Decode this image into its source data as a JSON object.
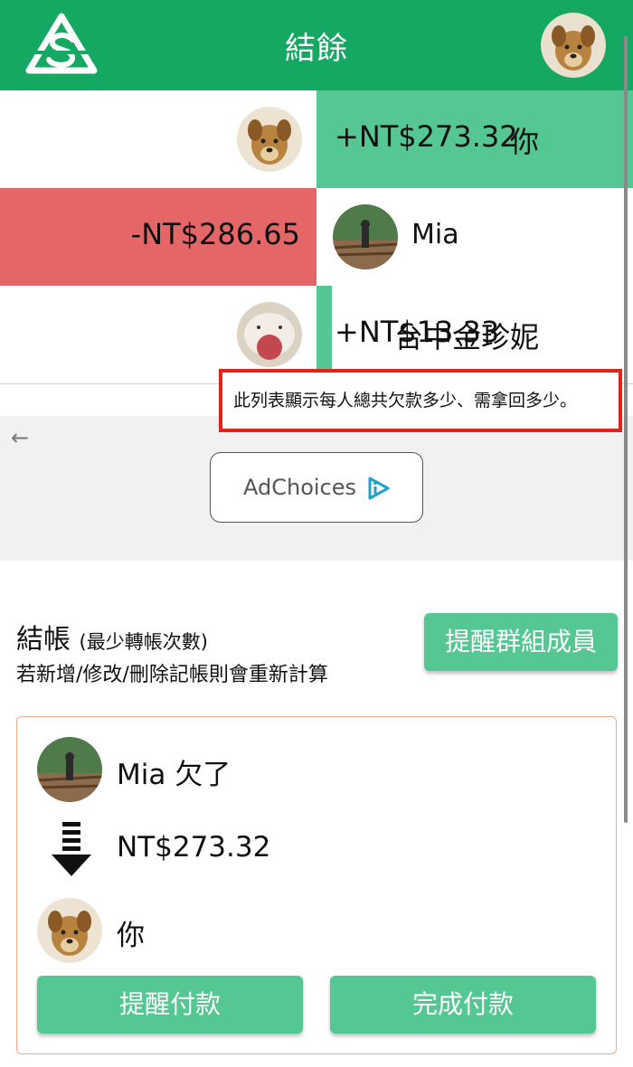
{
  "header": {
    "title": "結餘",
    "logo_icon": "splitwise-logo-icon",
    "brand_color": "#14a862"
  },
  "balances": [
    {
      "name": "你",
      "amount": "+NT$273.32",
      "direction": "positive",
      "bar_fraction": 1.0
    },
    {
      "name": "Mia",
      "amount": "-NT$286.65",
      "direction": "negative",
      "bar_fraction": 1.0
    },
    {
      "name": "台中金珍妮",
      "amount": "+NT$13.33",
      "direction": "positive",
      "bar_fraction": 0.05
    }
  ],
  "annotation": {
    "text": "此列表顯示每人總共欠款多少、需拿回多少。"
  },
  "ad": {
    "label": "AdChoices"
  },
  "settle": {
    "title": "結帳",
    "subtitle": "(最少轉帳次數)",
    "description": "若新增/修改/刪除記帳則會重新計算",
    "remind_group_label": "提醒群組成員",
    "transfer": {
      "debtor_text": "Mia 欠了",
      "amount": "NT$273.32",
      "creditor_text": "你",
      "remind_label": "提醒付款",
      "complete_label": "完成付款"
    }
  },
  "colors": {
    "positive": "#55c792",
    "negative": "#e56666",
    "annotation_border": "#e2231a"
  }
}
